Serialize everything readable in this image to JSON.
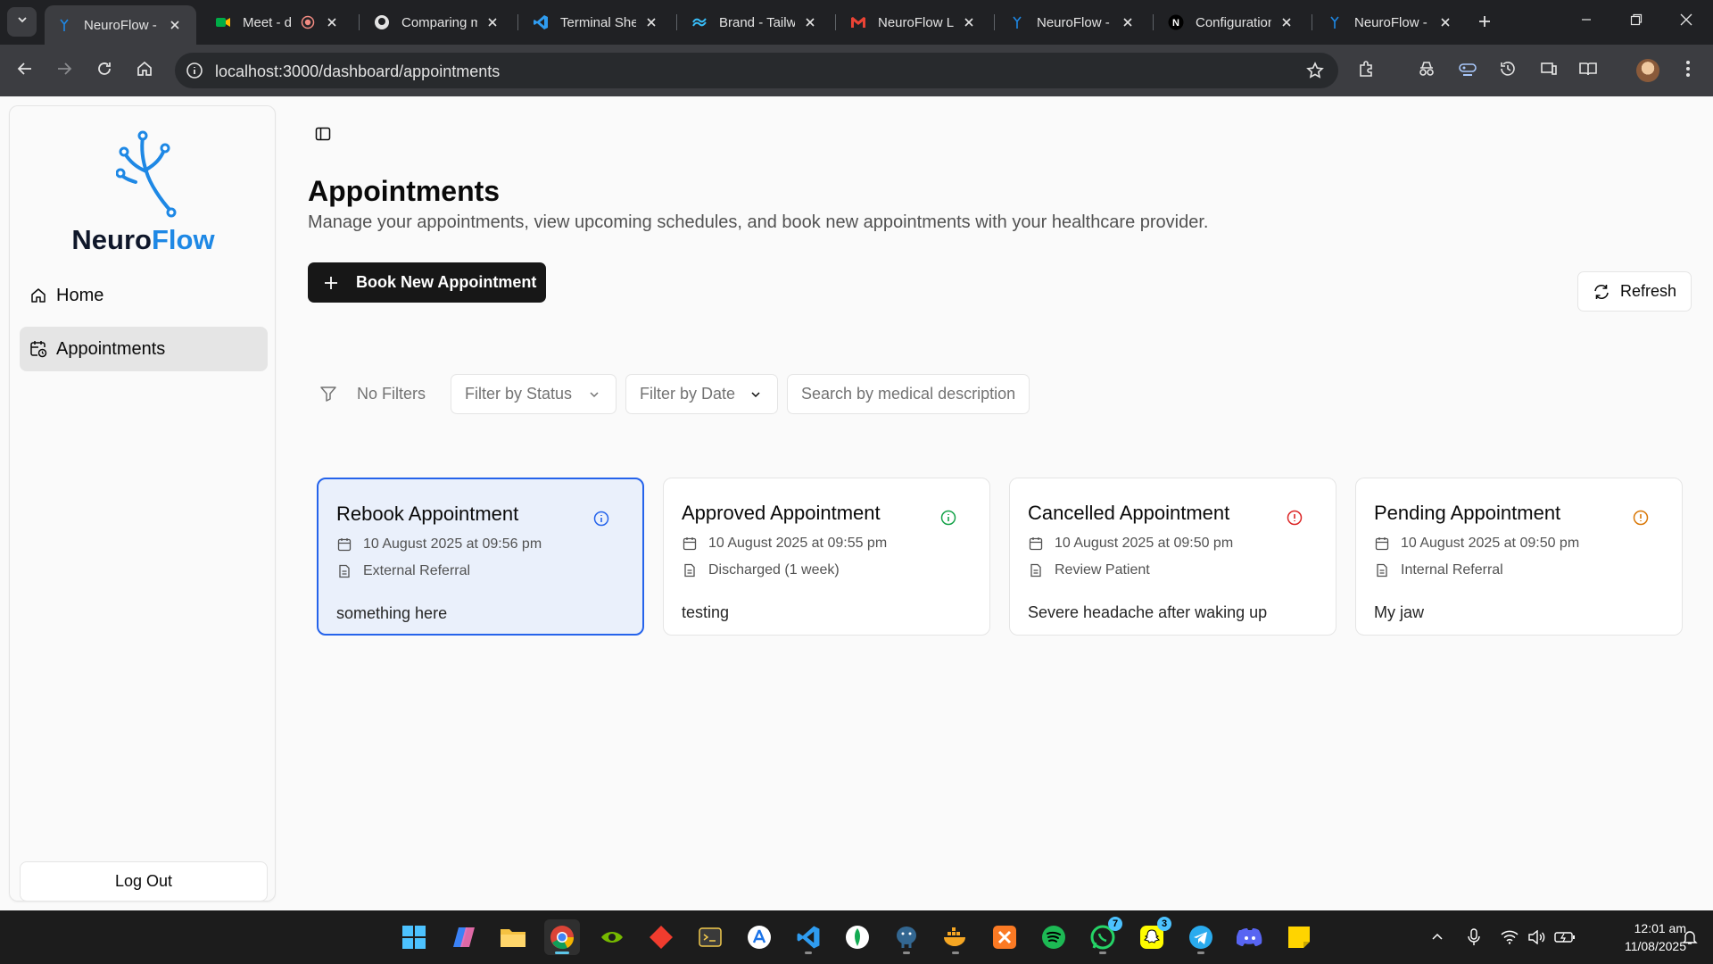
{
  "browser": {
    "tabs": [
      {
        "title": "NeuroFlow - ",
        "icon": "neuroflow-icon",
        "active": true
      },
      {
        "title": "Meet - dc",
        "icon": "google-meet-icon",
        "active": false
      },
      {
        "title": "Comparing m",
        "icon": "github-icon",
        "active": false
      },
      {
        "title": "Terminal Shel",
        "icon": "vscode-icon",
        "active": false
      },
      {
        "title": "Brand - Tailwi",
        "icon": "tailwind-icon",
        "active": false
      },
      {
        "title": "NeuroFlow Lo",
        "icon": "gmail-icon",
        "active": false
      },
      {
        "title": "NeuroFlow - ",
        "icon": "neuroflow-icon",
        "active": false
      },
      {
        "title": "Configuration",
        "icon": "notion-icon",
        "active": false
      },
      {
        "title": "NeuroFlow - ",
        "icon": "neuroflow-icon",
        "active": false
      }
    ],
    "url": "localhost:3000/dashboard/appointments"
  },
  "sidebar": {
    "brand_part1": "Neuro",
    "brand_part2": "Flow",
    "brand_color": "#1e88e5",
    "items": [
      {
        "label": "Home",
        "icon": "home-icon",
        "active": false
      },
      {
        "label": "Appointments",
        "icon": "calendar-clock-icon",
        "active": true
      }
    ],
    "logout_label": "Log Out"
  },
  "main": {
    "title": "Appointments",
    "description": "Manage your appointments, view upcoming schedules, and book new appointments with your healthcare provider.",
    "book_label": "Book New Appointment",
    "refresh_label": "Refresh",
    "filters": {
      "label": "No Filters",
      "status_placeholder": "Filter by Status",
      "date_placeholder": "Filter by Date",
      "search_placeholder": "Search by medical description"
    },
    "cards": [
      {
        "title": "Rebook Appointment",
        "datetime": "10 August 2025 at 09:56 pm",
        "type": "External Referral",
        "description": "something here",
        "status_color": "#2563eb",
        "selected": true
      },
      {
        "title": "Approved Appointment",
        "datetime": "10 August 2025 at 09:55 pm",
        "type": "Discharged (1 week)",
        "description": "testing",
        "status_color": "#16a34a",
        "selected": false
      },
      {
        "title": "Cancelled Appointment",
        "datetime": "10 August 2025 at 09:50 pm",
        "type": "Review Patient",
        "description": "Severe headache after waking up",
        "status_color": "#dc2626",
        "selected": false
      },
      {
        "title": "Pending Appointment",
        "datetime": "10 August 2025 at 09:50 pm",
        "type": "Internal Referral",
        "description": "My jaw",
        "status_color": "#d97706",
        "selected": false
      }
    ]
  },
  "taskbar": {
    "apps": [
      "windows-start-icon",
      "copilot-icon",
      "file-explorer-icon",
      "chrome-icon",
      "nvidia-icon",
      "git-kraken-icon",
      "terminal-icon",
      "app-store-icon",
      "vscode-icon",
      "mongodb-icon",
      "postgresql-icon",
      "docker-icon",
      "xampp-icon",
      "spotify-icon",
      "whatsapp-icon",
      "snapchat-icon",
      "telegram-icon",
      "discord-icon",
      "sticky-notes-icon"
    ],
    "whatsapp_badge": "7",
    "snapchat_badge": "3",
    "time": "12:01 am",
    "date": "11/08/2025"
  }
}
